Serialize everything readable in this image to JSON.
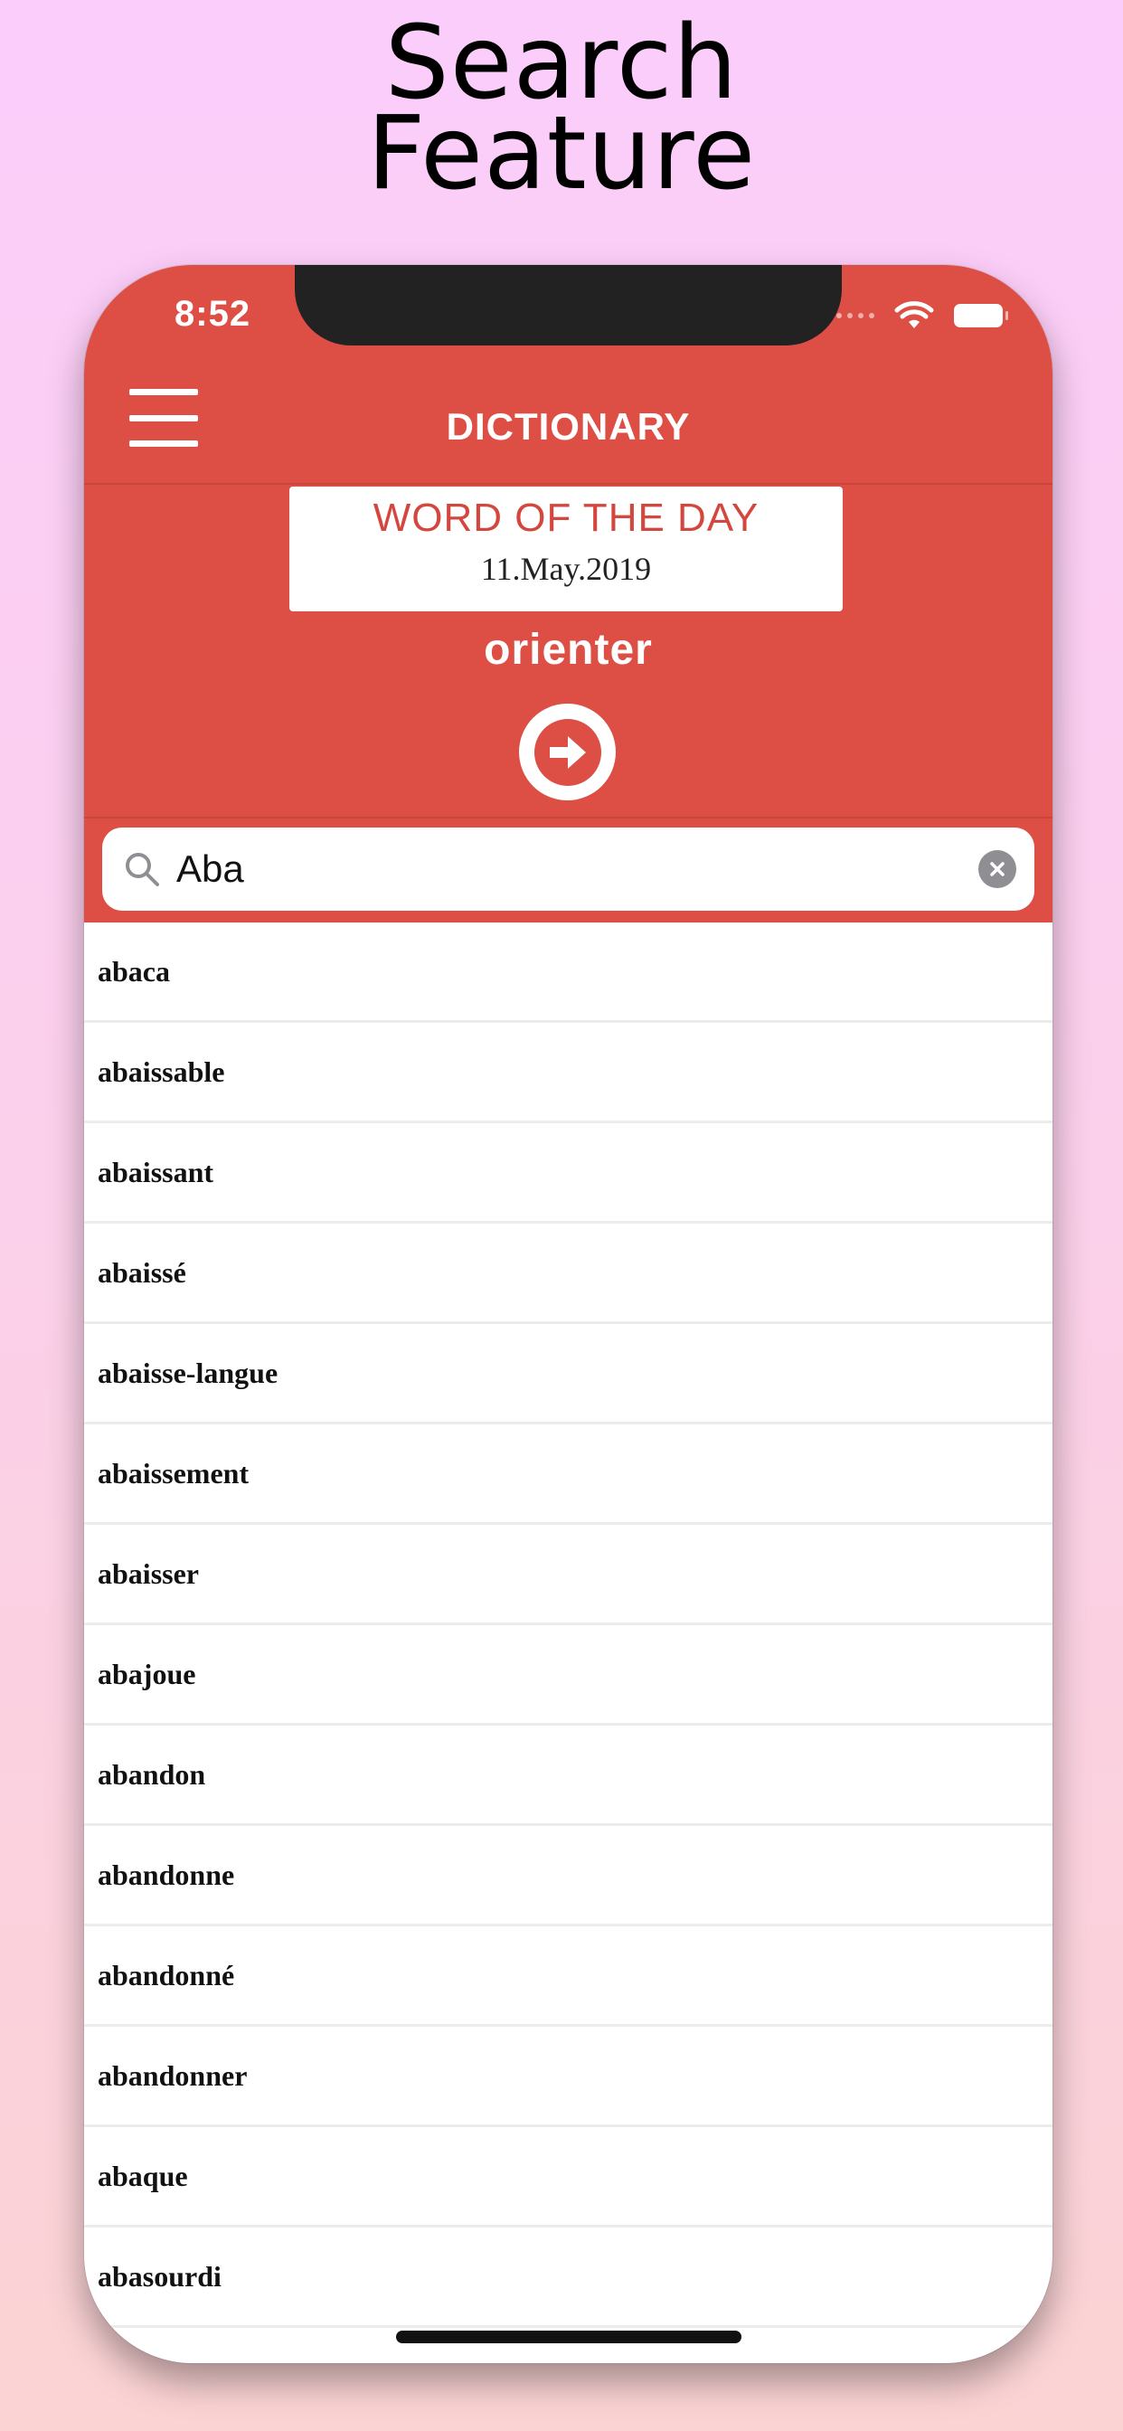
{
  "headline": {
    "line1": "Search",
    "line2": "Feature"
  },
  "status_bar": {
    "time": "8:52"
  },
  "nav": {
    "title": "DICTIONARY"
  },
  "word_of_the_day": {
    "label": "WORD OF THE DAY",
    "date": "11.May.2019",
    "word": "orienter"
  },
  "search": {
    "value": "Aba"
  },
  "results": [
    "abaca",
    "abaissable",
    "abaissant",
    "abaissé",
    "abaisse-langue",
    "abaissement",
    "abaisser",
    "abajoue",
    "abandon",
    "abandonne",
    "abandonné",
    "abandonner",
    "abaque",
    "abasourdi"
  ],
  "colors": {
    "accent": "#dd4e45",
    "background_top": "#fbcdfb",
    "background_bottom": "#fbd3d3"
  },
  "icons": {
    "menu": "hamburger-icon",
    "search": "magnifier-icon",
    "clear": "clear-x-icon",
    "go": "arrow-right-circle-icon"
  }
}
